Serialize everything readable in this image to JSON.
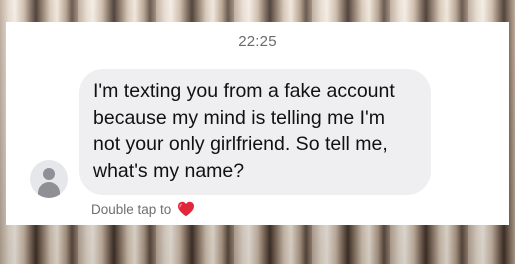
{
  "chat": {
    "timestamp": "22:25",
    "message": "I'm texting you from a fake account\nbecause my mind is telling me I'm\nnot your only girlfriend. So tell me,\nwhat's my name?",
    "reaction_hint": "Double tap to",
    "reaction_icon": "heart-icon",
    "reaction_color": "#e0283a"
  }
}
